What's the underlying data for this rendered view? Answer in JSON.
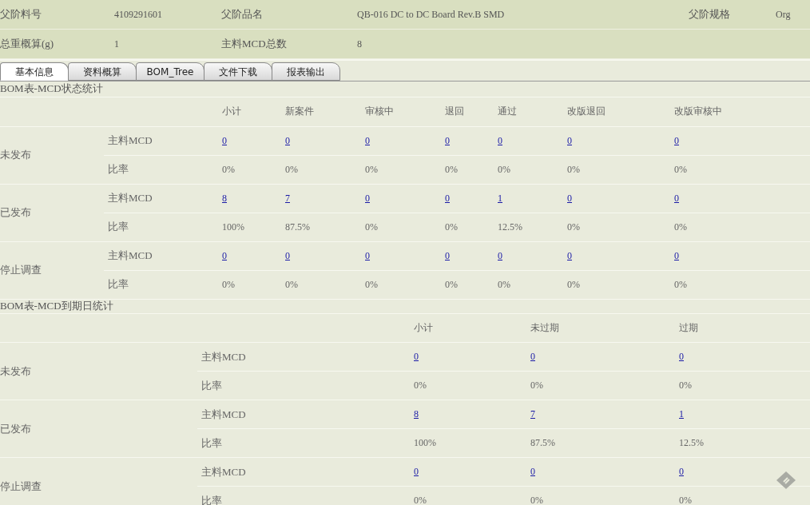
{
  "header": [
    [
      {
        "label": "父阶料号",
        "value": "4109291601"
      },
      {
        "label": "父阶品名",
        "value": "QB-016 DC to DC Board Rev.B SMD"
      },
      {
        "label": "父阶规格",
        "value": "Org"
      }
    ],
    [
      {
        "label": "总重概算(g)",
        "value": "1"
      },
      {
        "label": "主料MCD总数",
        "value": "8"
      }
    ]
  ],
  "tabs": [
    {
      "label": "基本信息",
      "selected": true
    },
    {
      "label": "资料概算",
      "selected": false
    },
    {
      "label": "BOM_Tree",
      "selected": false
    },
    {
      "label": "文件下载",
      "selected": false
    },
    {
      "label": "报表输出",
      "selected": false
    }
  ],
  "sections": [
    {
      "title": "BOM表-MCD状态统计",
      "columns": [
        "小计",
        "新案件",
        "审核中",
        "退回",
        "通过",
        "改版退回",
        "改版审核中"
      ],
      "groups": [
        {
          "name": "未发布",
          "rows": [
            {
              "label": "主料MCD",
              "kind": "link",
              "cells": [
                "0",
                "0",
                "0",
                "0",
                "0",
                "0",
                "0"
              ]
            },
            {
              "label": "比率",
              "kind": "text",
              "cells": [
                "0%",
                "0%",
                "0%",
                "0%",
                "0%",
                "0%",
                "0%"
              ]
            }
          ]
        },
        {
          "name": "已发布",
          "rows": [
            {
              "label": "主料MCD",
              "kind": "link",
              "cells": [
                "8",
                "7",
                "0",
                "0",
                "1",
                "0",
                "0"
              ]
            },
            {
              "label": "比率",
              "kind": "text",
              "cells": [
                "100%",
                "87.5%",
                "0%",
                "0%",
                "12.5%",
                "0%",
                "0%"
              ]
            }
          ]
        },
        {
          "name": "停止调查",
          "rows": [
            {
              "label": "主料MCD",
              "kind": "link",
              "cells": [
                "0",
                "0",
                "0",
                "0",
                "0",
                "0",
                "0"
              ]
            },
            {
              "label": "比率",
              "kind": "text",
              "cells": [
                "0%",
                "0%",
                "0%",
                "0%",
                "0%",
                "0%",
                "0%"
              ]
            }
          ]
        }
      ]
    },
    {
      "title": "BOM表-MCD到期日统计",
      "columns": [
        "小计",
        "未过期",
        "过期"
      ],
      "groups": [
        {
          "name": "未发布",
          "rows": [
            {
              "label": "主料MCD",
              "kind": "link",
              "cells": [
                "0",
                "0",
                "0"
              ]
            },
            {
              "label": "比率",
              "kind": "text",
              "cells": [
                "0%",
                "0%",
                "0%"
              ]
            }
          ]
        },
        {
          "name": "已发布",
          "rows": [
            {
              "label": "主料MCD",
              "kind": "link",
              "cells": [
                "8",
                "7",
                "1"
              ]
            },
            {
              "label": "比率",
              "kind": "text",
              "cells": [
                "100%",
                "87.5%",
                "12.5%"
              ]
            }
          ]
        },
        {
          "name": "停止调查",
          "rows": [
            {
              "label": "主料MCD",
              "kind": "link",
              "cells": [
                "0",
                "0",
                "0"
              ]
            },
            {
              "label": "比率",
              "kind": "text",
              "cells": [
                "0%",
                "0%",
                "0%"
              ]
            }
          ]
        }
      ]
    }
  ]
}
